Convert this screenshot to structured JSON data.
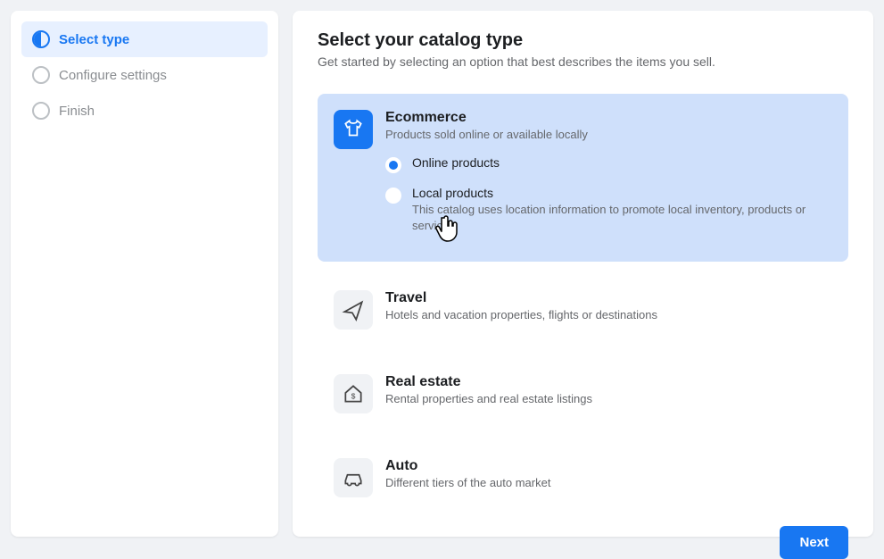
{
  "sidebar": {
    "steps": [
      {
        "label": "Select type"
      },
      {
        "label": "Configure settings"
      },
      {
        "label": "Finish"
      }
    ]
  },
  "main": {
    "title": "Select your catalog type",
    "subtitle": "Get started by selecting an option that best describes the items you sell.",
    "options": {
      "ecommerce": {
        "title": "Ecommerce",
        "desc": "Products sold online or available locally",
        "radios": {
          "online": {
            "label": "Online products"
          },
          "local": {
            "label": "Local products",
            "sub": "This catalog uses location information to promote local inventory, products or services."
          }
        }
      },
      "travel": {
        "title": "Travel",
        "desc": "Hotels and vacation properties, flights or destinations"
      },
      "realestate": {
        "title": "Real estate",
        "desc": "Rental properties and real estate listings"
      },
      "auto": {
        "title": "Auto",
        "desc": "Different tiers of the auto market"
      }
    },
    "next": "Next"
  }
}
